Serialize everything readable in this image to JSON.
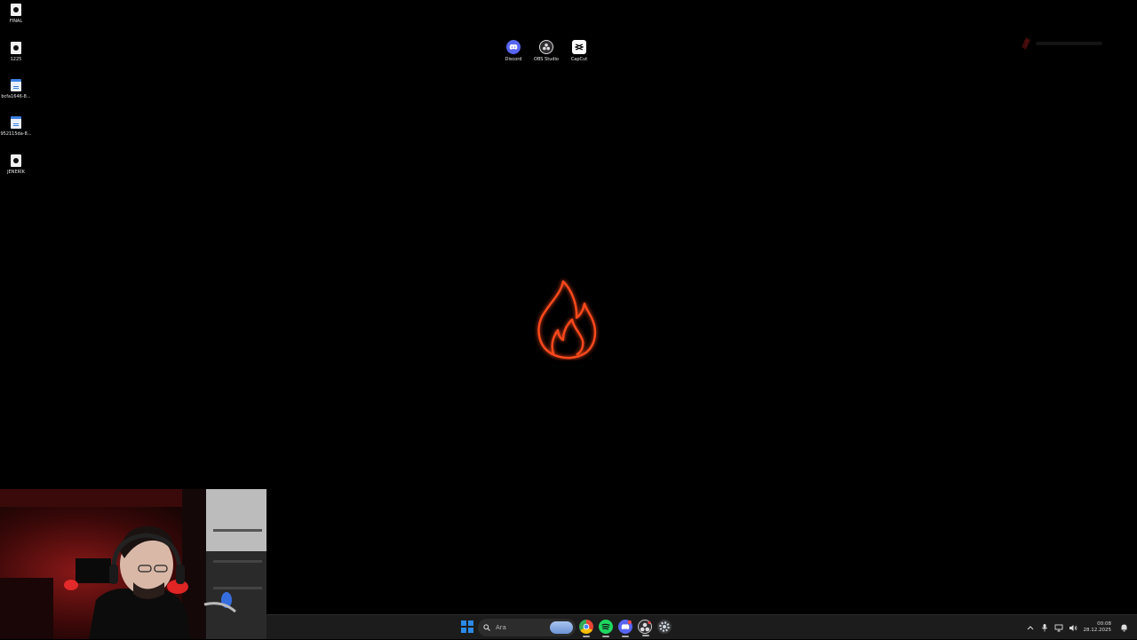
{
  "desktop": {
    "left_icons": [
      {
        "label": "FINAL",
        "icon": "video-file-icon"
      },
      {
        "label": "1225",
        "icon": "video-file-icon"
      },
      {
        "label": "bcfa1646-8...",
        "icon": "document-file-icon"
      },
      {
        "label": "952115da-8...",
        "icon": "document-file-icon"
      },
      {
        "label": "JENERİK",
        "icon": "video-file-icon"
      }
    ],
    "top_icons": [
      {
        "label": "Discord",
        "icon": "discord-icon",
        "color": "#5865f2"
      },
      {
        "label": "OBS Studio",
        "icon": "obs-icon",
        "color": "#302e31"
      },
      {
        "label": "CapCut",
        "icon": "capcut-icon",
        "color": "#ffffff"
      }
    ],
    "wallpaper_icon": "flame-icon",
    "accent_color": "#ff4a1c"
  },
  "taskbar": {
    "search_placeholder": "Ara",
    "apps": [
      {
        "name": "chrome-icon"
      },
      {
        "name": "spotify-icon"
      },
      {
        "name": "discord-icon"
      },
      {
        "name": "obs-icon"
      },
      {
        "name": "settings-icon"
      }
    ],
    "clock": {
      "time": "00:08",
      "date": "28.12.2025"
    }
  }
}
